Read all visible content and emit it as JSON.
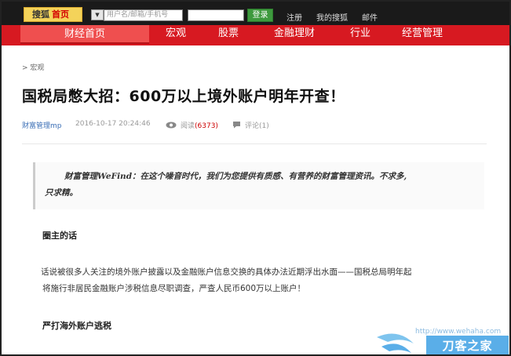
{
  "topbar": {
    "logo_part1": "搜狐",
    "logo_part2": "首页",
    "username_placeholder": "用户名/邮箱/手机号",
    "login_label": "登录",
    "links": [
      "注册",
      "我的搜狐",
      "邮件"
    ]
  },
  "nav": {
    "home_label": "财经首页",
    "items": [
      "宏观",
      "股票",
      "金融理财",
      "行业",
      "经营管理"
    ]
  },
  "breadcrumb": "> 宏观",
  "article": {
    "title": "国税局憋大招：600万以上境外账户明年开查！",
    "author": "财富管理mp",
    "datetime": "2016-10-17 20:24:46",
    "read_label": "阅读",
    "read_count": "(6373)",
    "comment_label": "评论(1)",
    "quote_line1": "财富管理WeFind：在这个噪音时代，我们为您提供有质感、有营养的财富管理资讯。不求多,",
    "quote_line2": "只求精。",
    "section1_heading": "圈主的话",
    "paragraph1_line1": "话说被很多人关注的境外账户披露以及金融账户信息交换的具体办法近期浮出水面——国税总局明年起",
    "paragraph1_line2": "将施行非居民金融账户涉税信息尽职调查，严查人民币600万以上账户！",
    "section2_heading": "严打海外账户逃税"
  },
  "watermark": {
    "url": "http://www.wehaha.com",
    "brand": "刀客之家"
  },
  "colors": {
    "nav_red": "#d71921",
    "link_blue": "#3b6fb6",
    "count_red": "#cc0000"
  }
}
